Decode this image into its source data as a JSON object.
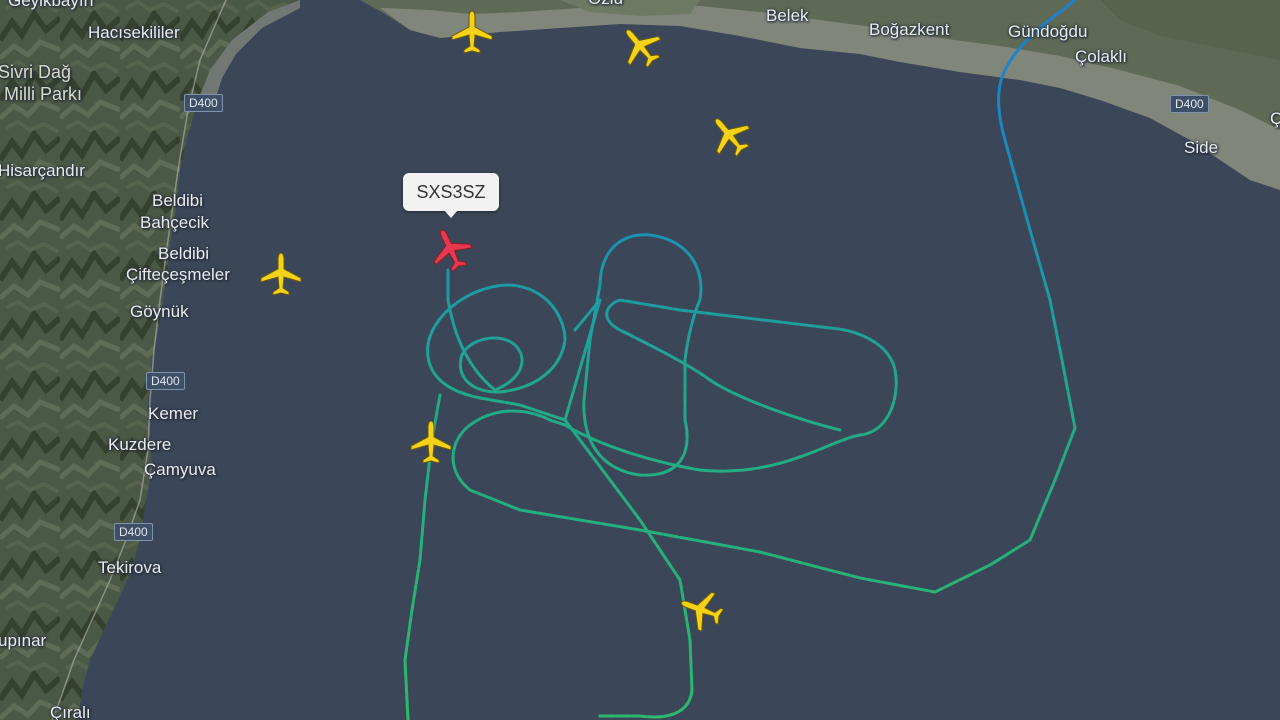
{
  "map": {
    "colors": {
      "sea": "#3b4758",
      "land_dark": "#3f4b3c",
      "land_mid": "#5a6752",
      "coast_urban": "#8b8e86",
      "track_green": "#2db96a",
      "track_teal": "#1d9e9a",
      "track_blue": "#1c7fd3",
      "aircraft_yellow": "#f5d21a",
      "aircraft_selected": "#e8384f"
    },
    "places": [
      {
        "id": "geyikbayiri",
        "label": "Geyikbayırı"
      },
      {
        "id": "hacisekililer",
        "label": "Hacısekililer"
      },
      {
        "id": "sivri-dag",
        "label": "Sivri Dağ"
      },
      {
        "id": "milli-parki",
        "label": "Milli Parkı"
      },
      {
        "id": "hisarcandir",
        "label": "Hisarçandır"
      },
      {
        "id": "beldibi-1",
        "label": "Beldibi"
      },
      {
        "id": "bahcecik",
        "label": "Bahçecik"
      },
      {
        "id": "beldibi-2",
        "label": "Beldibi"
      },
      {
        "id": "ciftecesmeler",
        "label": "Çifteçeşmeler"
      },
      {
        "id": "goynuk",
        "label": "Göynük"
      },
      {
        "id": "kemer",
        "label": "Kemer"
      },
      {
        "id": "kuzdere",
        "label": "Kuzdere"
      },
      {
        "id": "camyuva",
        "label": "Çamyuva"
      },
      {
        "id": "tekirova",
        "label": "Tekirova"
      },
      {
        "id": "ulupinar",
        "label": "upınar"
      },
      {
        "id": "cirali",
        "label": "Çıralı"
      },
      {
        "id": "ozlu",
        "label": "Özlü"
      },
      {
        "id": "belek",
        "label": "Belek"
      },
      {
        "id": "bogazkent",
        "label": "Boğazkent"
      },
      {
        "id": "gundogdu",
        "label": "Gündoğdu"
      },
      {
        "id": "colakli",
        "label": "Çolaklı"
      },
      {
        "id": "side",
        "label": "Side"
      },
      {
        "id": "edge-c",
        "label": "Ç"
      }
    ],
    "roads": [
      {
        "id": "d400-1",
        "label": "D400"
      },
      {
        "id": "d400-2",
        "label": "D400"
      },
      {
        "id": "d400-3",
        "label": "D400"
      },
      {
        "id": "d400-4",
        "label": "D400"
      }
    ],
    "selected_flight": {
      "callsign": "SXS3SZ"
    },
    "aircraft": [
      {
        "id": "plane-selected",
        "icon": "airplane-icon",
        "selected": true,
        "heading_deg": -25
      },
      {
        "id": "plane-coast-1",
        "icon": "airplane-icon",
        "selected": false,
        "heading_deg": 0
      },
      {
        "id": "plane-coast-2",
        "icon": "airplane-icon",
        "selected": false,
        "heading_deg": -40
      },
      {
        "id": "plane-east",
        "icon": "airplane-icon",
        "selected": false,
        "heading_deg": -40
      },
      {
        "id": "plane-west",
        "icon": "airplane-icon",
        "selected": false,
        "heading_deg": 0
      },
      {
        "id": "plane-track",
        "icon": "airplane-icon",
        "selected": false,
        "heading_deg": 0
      },
      {
        "id": "plane-south",
        "icon": "airplane-icon",
        "selected": false,
        "heading_deg": -70
      }
    ]
  }
}
